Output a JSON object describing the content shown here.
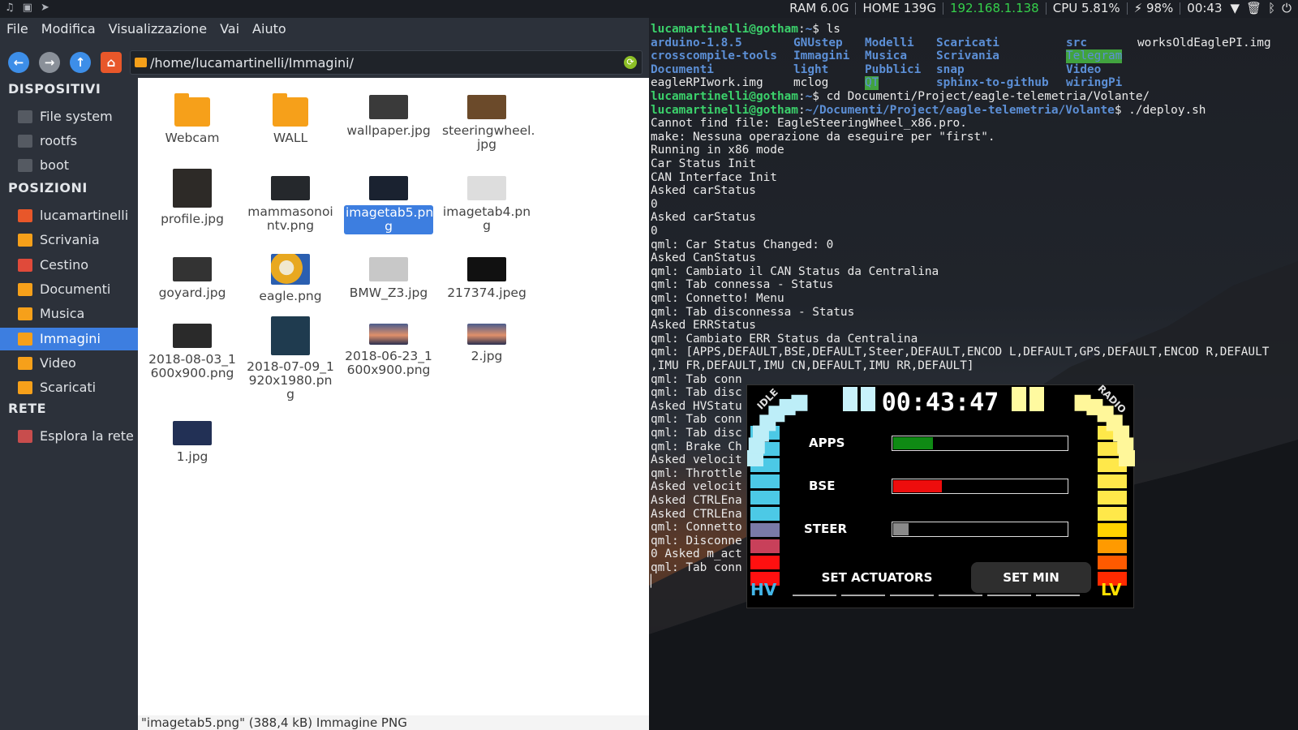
{
  "topbar": {
    "ram": "RAM 6.0G",
    "home": "HOME 139G",
    "ip": "192.168.1.138",
    "cpu": "CPU 5.81%",
    "battery": "⚡ 98%",
    "time": "00:43",
    "colors": {
      "ip": "#35d04b"
    }
  },
  "menu": [
    "File",
    "Modifica",
    "Visualizzazione",
    "Vai",
    "Aiuto"
  ],
  "path": "/home/lucamartinelli/Immagini/",
  "sidebar": {
    "devices_title": "DISPOSITIVI",
    "devices": [
      {
        "label": "File system"
      },
      {
        "label": "rootfs"
      },
      {
        "label": "boot"
      }
    ],
    "places_title": "POSIZIONI",
    "places": [
      {
        "label": "lucamartinelli",
        "icon": "home-folder-icon"
      },
      {
        "label": "Scrivania",
        "icon": "folder-icon"
      },
      {
        "label": "Cestino",
        "icon": "trash-icon"
      },
      {
        "label": "Documenti",
        "icon": "folder-icon"
      },
      {
        "label": "Musica",
        "icon": "music-folder-icon"
      },
      {
        "label": "Immagini",
        "icon": "pictures-folder-icon"
      },
      {
        "label": "Video",
        "icon": "folder-icon"
      },
      {
        "label": "Scaricati",
        "icon": "folder-icon"
      }
    ],
    "network_title": "RETE",
    "network": [
      {
        "label": "Esplora la rete"
      }
    ]
  },
  "files": [
    {
      "name": "Webcam",
      "kind": "folder"
    },
    {
      "name": "WALL",
      "kind": "folder"
    },
    {
      "name": "wallpaper.jpg",
      "kind": "image"
    },
    {
      "name": "steeringwheel.\njpg",
      "kind": "image"
    },
    {
      "name": "profile.jpg",
      "kind": "image"
    },
    {
      "name": "mammasonoi\nntv.png",
      "kind": "image"
    },
    {
      "name": "imagetab5.pn\ng",
      "kind": "image"
    },
    {
      "name": "imagetab4.pn\ng",
      "kind": "image"
    },
    {
      "name": "goyard.jpg",
      "kind": "image"
    },
    {
      "name": "eagle.png",
      "kind": "image"
    },
    {
      "name": "BMW_Z3.jpg",
      "kind": "image"
    },
    {
      "name": "217374.jpeg",
      "kind": "image"
    },
    {
      "name": "2018-08-03_1\n600x900.png",
      "kind": "image"
    },
    {
      "name": "2018-07-09_1\n920x1980.pn\ng",
      "kind": "image"
    },
    {
      "name": "2018-06-23_1\n600x900.png",
      "kind": "image"
    },
    {
      "name": "2.jpg",
      "kind": "image"
    },
    {
      "name": "1.jpg",
      "kind": "image"
    }
  ],
  "status": "\"imagetab5.png\" (388,4 kB) Immagine PNG",
  "terminal": {
    "user": "lucamartinelli",
    "host": "gotham",
    "prompt1_cmd": "ls",
    "ls": [
      [
        "arduino-1.8.5",
        "GNUstep",
        "Modelli",
        "Scaricati",
        "src",
        "worksOldEaglePI.img"
      ],
      [
        "crosscompile-tools",
        "Immagini",
        "Musica",
        "Scrivania",
        "Telegram",
        ""
      ],
      [
        "Documenti",
        "light",
        "Pubblici",
        "snap",
        "Video",
        ""
      ],
      [
        "eagleRPIwork.img",
        "mclog",
        "QT",
        "sphinx-to-github",
        "wiringPi",
        ""
      ]
    ],
    "prompt2_cmd": "cd Documenti/Project/eagle-telemetria/Volante/",
    "prompt3_path": "~/Documenti/Project/eagle-telemetria/Volante",
    "prompt3_cmd": "./deploy.sh",
    "lines": [
      "Cannot find file: EagleSteeringWheel_x86.pro.",
      "make: Nessuna operazione da eseguire per \"first\".",
      "Running in x86 mode",
      "Car Status Init",
      "CAN Interface Init",
      "Asked carStatus",
      "0",
      "Asked carStatus",
      "0",
      "qml: Car Status Changed: 0",
      "Asked CanStatus",
      "qml: Cambiato il CAN Status da Centralina",
      "qml: Tab connessa - Status",
      "qml: Connetto! Menu",
      "qml: Tab disconnessa - Status",
      "Asked ERRStatus",
      "qml: Cambiato ERR Status da Centralina",
      "qml: [APPS,DEFAULT,BSE,DEFAULT,Steer,DEFAULT,ENCOD L,DEFAULT,GPS,DEFAULT,ENCOD R,DEFAULT",
      ",IMU FR,DEFAULT,IMU CN,DEFAULT,IMU RR,DEFAULT]",
      "qml: Tab conn",
      "qml: Tab disc",
      "Asked HVStatu",
      "qml: Tab conn",
      "qml: Tab disc",
      "qml: Brake Ch",
      "Asked velocit",
      "qml: Throttle",
      "Asked velocit",
      "Asked CTRLEna",
      "Asked CTRLEna",
      "qml: Connetto",
      "qml: Disconne",
      "0 Asked m_act",
      "qml: Tab conn"
    ]
  },
  "dashboard": {
    "clock": "00:43:47",
    "idle": "IDLE",
    "radio": "RADIO",
    "hv": "HV",
    "lv": "LV",
    "bars": [
      {
        "label": "APPS",
        "level": 0.23,
        "color": "#0f8a14"
      },
      {
        "label": "BSE",
        "level": 0.28,
        "color": "#ee0d0d"
      },
      {
        "label": "STEER",
        "level": 0.09,
        "color": "#8a8a8a"
      }
    ],
    "btn_actuators": "SET ACTUATORS",
    "btn_min": "SET MIN",
    "colors": {
      "left": "#4cc9e6",
      "right": "#ffe84a"
    }
  }
}
